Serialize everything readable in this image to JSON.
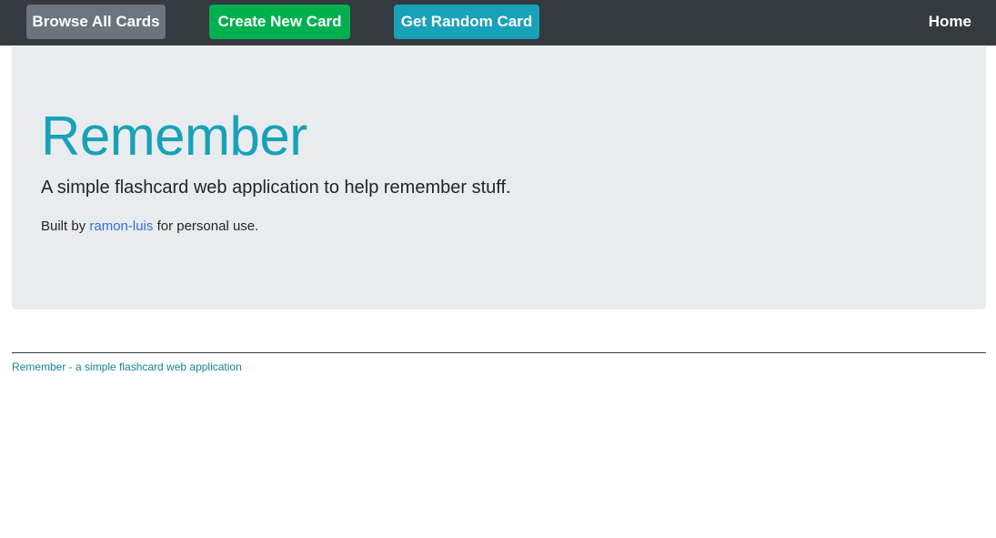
{
  "navbar": {
    "browse_label": "Browse All Cards",
    "create_label": "Create New Card",
    "random_label": "Get Random Card",
    "home_label": "Home"
  },
  "hero": {
    "title": "Remember",
    "lead": "A simple flashcard web application to help remember stuff.",
    "byline_prefix": "Built by",
    "author_link": "ramon-luis",
    "byline_suffix": "for personal use."
  },
  "footer": {
    "link_text": "Remember - a simple flashcard web application"
  },
  "colors": {
    "navbar_bg": "#343a40",
    "browse_btn": "#6c757d",
    "create_btn": "#00b04f",
    "random_btn": "#17a2b8",
    "jumbotron_bg": "#e9ecef",
    "title": "#17a2b8",
    "link": "#2f6fe0"
  }
}
